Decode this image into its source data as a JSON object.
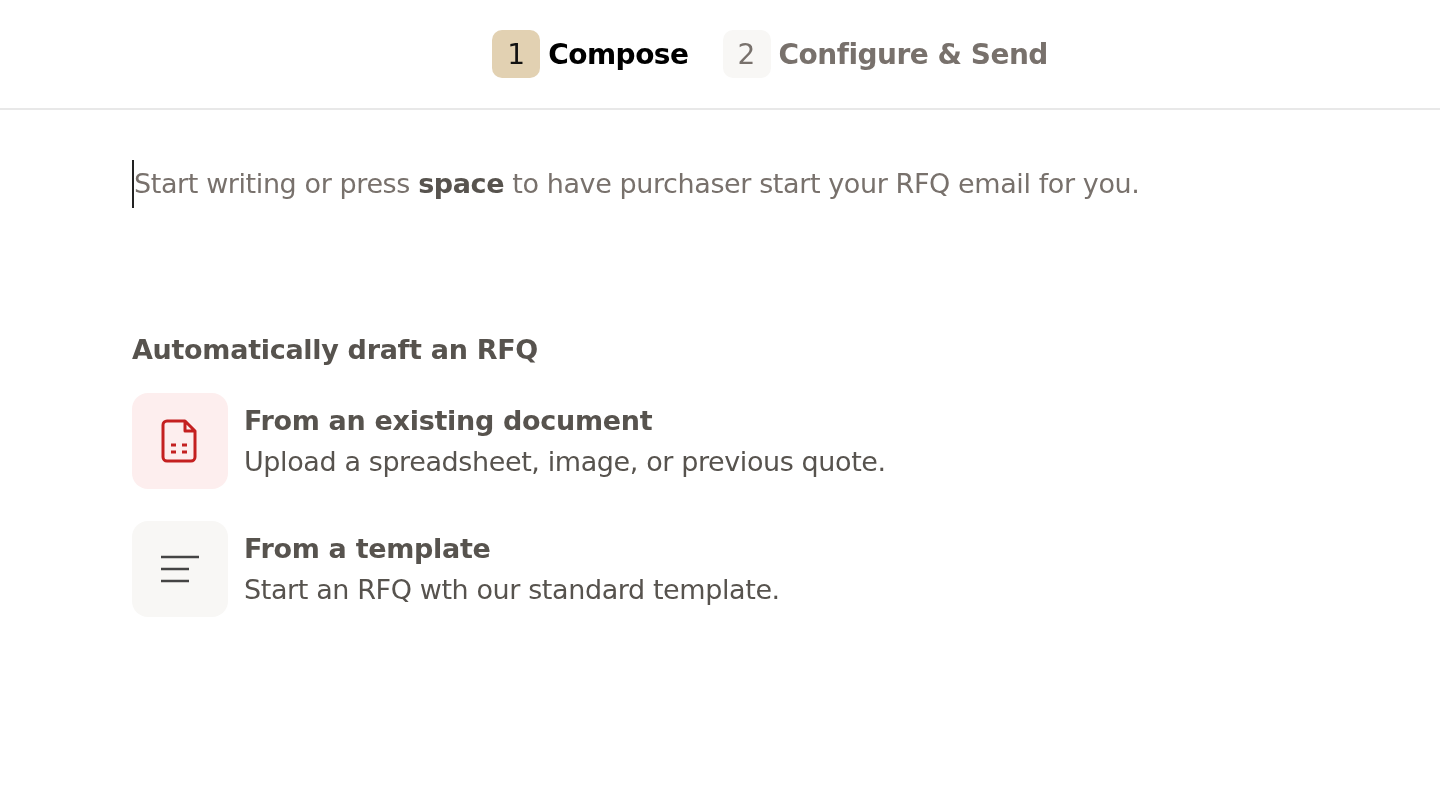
{
  "steps": [
    {
      "number": "1",
      "label": "Compose",
      "selected": true
    },
    {
      "number": "2",
      "label": "Configure & Send",
      "selected": false
    }
  ],
  "editor": {
    "placeholder": "Start writing or press **space** to have purchaser start your RFQ email for you."
  },
  "draft_section": {
    "heading": "Automatically draft an RFQ",
    "options": [
      {
        "kind": "document",
        "title": "From an existing document",
        "description": "Upload a spreadsheet, image, or previous quote."
      },
      {
        "kind": "template",
        "title": "From a template",
        "description": "Start an RFQ wth our standard template."
      }
    ]
  }
}
